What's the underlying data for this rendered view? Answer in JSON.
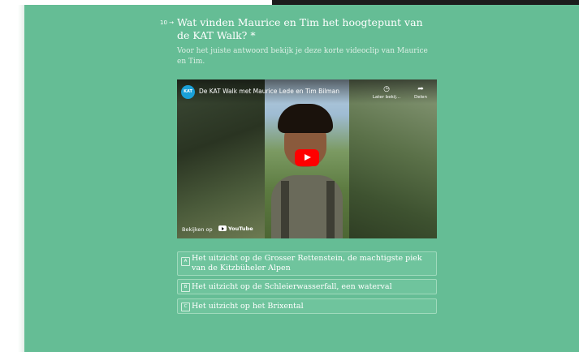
{
  "question": {
    "number": "10",
    "arrow": "→",
    "title": "Wat vinden Maurice en Tim het hoogtepunt van de KAT Walk? *",
    "description": "Voor het juiste antwoord bekijk je deze korte videoclip van Maurice en Tim."
  },
  "video": {
    "channel_logo_text": "KAT",
    "title": "De KAT Walk met Maurice Lede en Tim Bilman",
    "watch_later_label": "Later bekij...",
    "share_label": "Delen",
    "watch_on_label": "Bekijken op",
    "youtube_label": "YouTube",
    "icons": {
      "watch_later": "clock-icon",
      "share": "share-arrow-icon",
      "play": "play-icon"
    }
  },
  "options": [
    {
      "key": "A",
      "text": "Het uitzicht op de Grosser Rettenstein, de machtigste piek van de Kitzbüheler Alpen"
    },
    {
      "key": "B",
      "text": "Het uitzicht op de Schleierwasserfall, een waterval"
    },
    {
      "key": "C",
      "text": "Het uitzicht op het Brixental"
    }
  ],
  "colors": {
    "form_background": "#65bd95",
    "option_border": "#9fdabc",
    "youtube_red": "#ff0000"
  }
}
